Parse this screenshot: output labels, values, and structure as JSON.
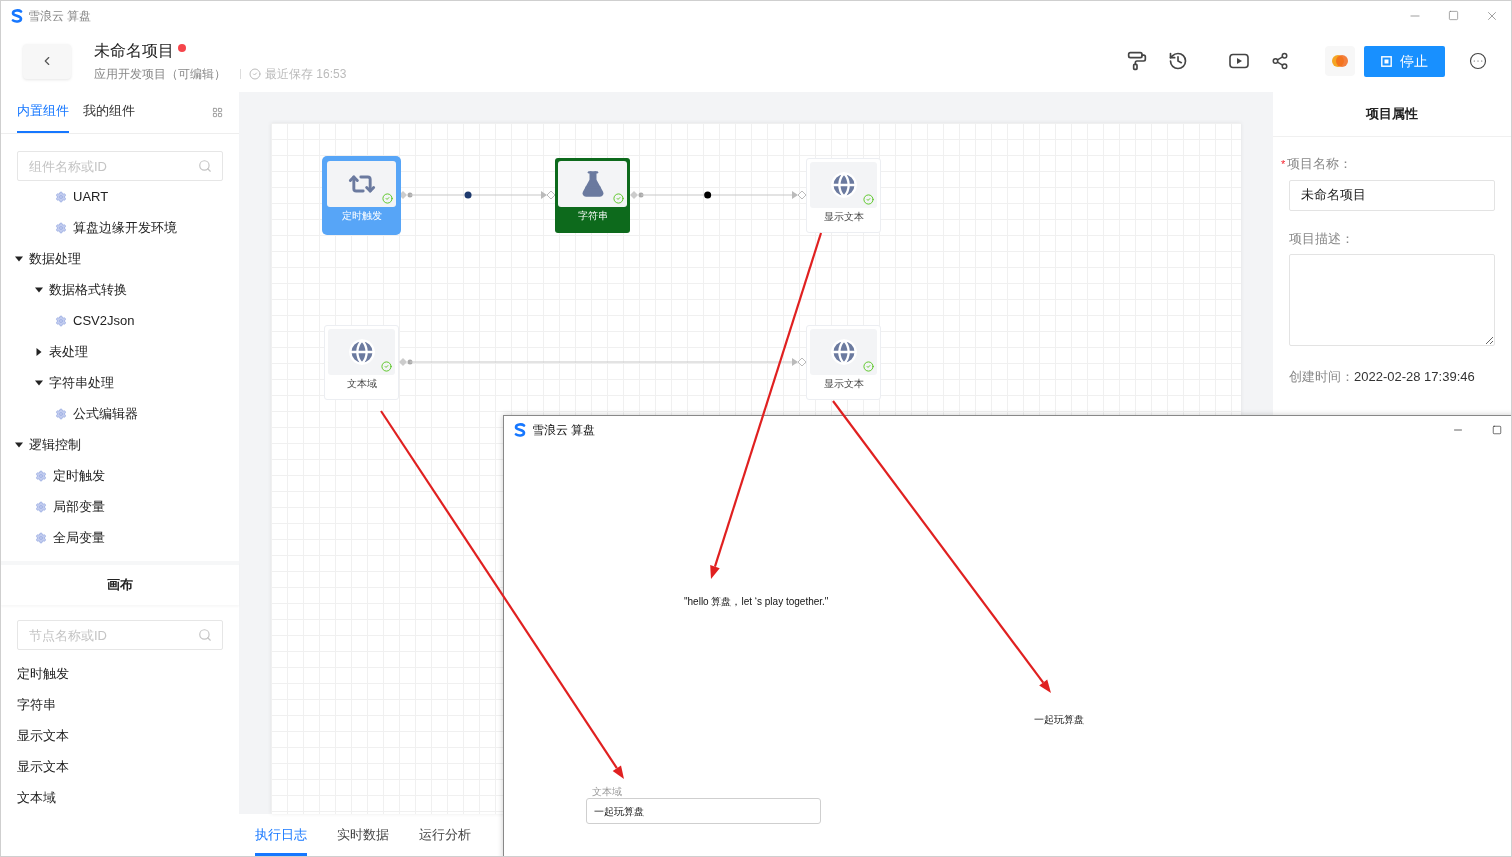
{
  "app_title": "雪浪云 算盘",
  "header": {
    "title": "未命名项目",
    "unsaved": true,
    "subtitle": "应用开发项目（可编辑）",
    "save_status": "最近保存 16:53",
    "stop_button": "停止"
  },
  "sidebar": {
    "tabs": [
      {
        "label": "内置组件",
        "selected": true
      },
      {
        "label": "我的组件",
        "selected": false
      }
    ],
    "search": {
      "placeholder": "组件名称或ID"
    },
    "tree": [
      {
        "children": [
          {
            "children": [
              {
                "label": "UART"
              },
              {
                "label": "算盘边缘开发环境"
              }
            ]
          }
        ]
      },
      {
        "label": "数据处理",
        "expanded": true,
        "children": [
          {
            "label": "数据格式转换",
            "expanded": true,
            "children": [
              {
                "label": "CSV2Json"
              }
            ]
          },
          {
            "label": "表处理",
            "expanded": false
          },
          {
            "label": "字符串处理",
            "expanded": true,
            "children": [
              {
                "label": "公式编辑器"
              }
            ]
          }
        ]
      },
      {
        "label": "逻辑控制",
        "expanded": true,
        "children": [
          {
            "label": "定时触发"
          },
          {
            "label": "局部变量"
          },
          {
            "label": "全局变量"
          }
        ]
      }
    ],
    "canvas_section": {
      "title": "画布",
      "search": {
        "placeholder": "节点名称或ID"
      },
      "nodes": [
        "定时触发",
        "字符串",
        "显示文本",
        "显示文本",
        "文本域"
      ]
    }
  },
  "canvas": {
    "nodes": [
      {
        "label": "定时触发",
        "kind": "timer",
        "selected": true,
        "running": false,
        "ok": true
      },
      {
        "label": "字符串",
        "kind": "string",
        "selected": false,
        "running": true,
        "ok": true
      },
      {
        "label": "显示文本",
        "kind": "display",
        "selected": false,
        "running": false,
        "ok": true
      },
      {
        "label": "文本域",
        "kind": "textarea",
        "selected": false,
        "running": false,
        "ok": true
      },
      {
        "label": "显示文本",
        "kind": "display",
        "selected": false,
        "running": false,
        "ok": true
      }
    ],
    "edges": [
      {
        "packet": true,
        "color": "#1e3a6e"
      },
      {
        "packet": true,
        "color": "#000000"
      },
      {
        "packet": false
      }
    ]
  },
  "bottom_tabs": [
    {
      "label": "执行日志",
      "selected": true
    },
    {
      "label": "实时数据",
      "selected": false
    },
    {
      "label": "运行分析",
      "selected": false
    }
  ],
  "properties": {
    "title": "项目属性",
    "name_label": "项目名称：",
    "required_mark": "*",
    "name_value": "未命名项目",
    "description_label": "项目描述：",
    "created_label": "创建时间：",
    "created_value": "2022-02-28 17:39:46"
  },
  "preview_window": {
    "title": "雪浪云 算盘",
    "text_1": "\"hello 算盘，let ‘s play together.\"",
    "text_2": "一起玩算盘",
    "textarea": {
      "label": "文本域",
      "value": "一起玩算盘"
    }
  }
}
